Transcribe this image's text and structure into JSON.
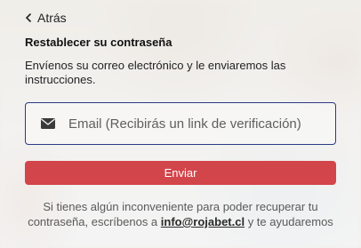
{
  "back": {
    "label": "Atrás",
    "icon": "chevron-left-icon"
  },
  "title": "Restablecer su contraseña",
  "description": "Envíenos su correo electrónico y le enviaremos las instrucciones.",
  "email_field": {
    "icon": "envelope-icon",
    "value": "",
    "placeholder": "Email (Recibirás un link de verificación)"
  },
  "send_button": {
    "label": "Enviar",
    "color": "#d2454a"
  },
  "help": {
    "text_before": "Si tienes algún inconveniente para poder recuperar tu contraseña, escríbenos a ",
    "email_link": "info@rojabet.cl",
    "text_after": " y te ayudaremos"
  },
  "colors": {
    "input_border": "#2b3b84",
    "button": "#d2454a"
  }
}
